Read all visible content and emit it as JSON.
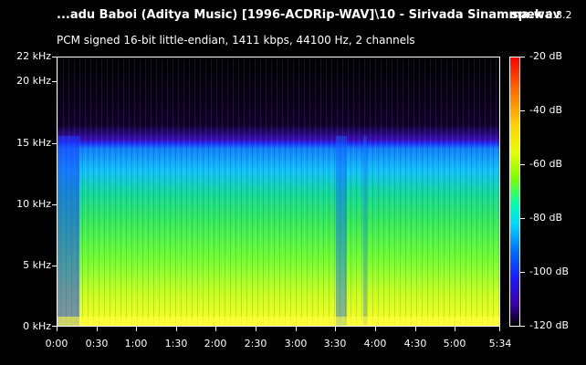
{
  "header": {
    "file_title": "...adu Baboi (Aditya Music) [1996-ACDRip-WAV]\\10 - Sirivada Sinamma.wav",
    "app_name": "spek",
    "app_version": "0.8.2",
    "audio_info": "PCM signed 16-bit little-endian, 1411 kbps, 44100 Hz, 2 channels"
  },
  "freq_axis": {
    "labels": [
      "22 kHz",
      "20 kHz",
      "15 kHz",
      "10 kHz",
      "5 kHz",
      "0 kHz"
    ],
    "values_khz": [
      22,
      20,
      15,
      10,
      5,
      0
    ],
    "max_khz": 22
  },
  "time_axis": {
    "labels": [
      "0:00",
      "0:30",
      "1:00",
      "1:30",
      "2:00",
      "2:30",
      "3:00",
      "3:30",
      "4:00",
      "4:30",
      "5:00",
      "5:34"
    ],
    "values_sec": [
      0,
      30,
      60,
      90,
      120,
      150,
      180,
      210,
      240,
      270,
      300,
      334
    ],
    "max_sec": 334
  },
  "db_scale": {
    "labels": [
      "-20 dB",
      "-40 dB",
      "-60 dB",
      "-80 dB",
      "-100 dB",
      "-120 dB"
    ],
    "values_db": [
      -20,
      -40,
      -60,
      -80,
      -100,
      -120
    ],
    "min_db": -120,
    "max_db": -20
  },
  "colors": {
    "background": "#000000",
    "text": "#ffffff",
    "cutoff_band": "#3a20d8",
    "low_band": "#ffff40",
    "mid_band": "#40e060",
    "high_band": "#18c0ff"
  }
}
